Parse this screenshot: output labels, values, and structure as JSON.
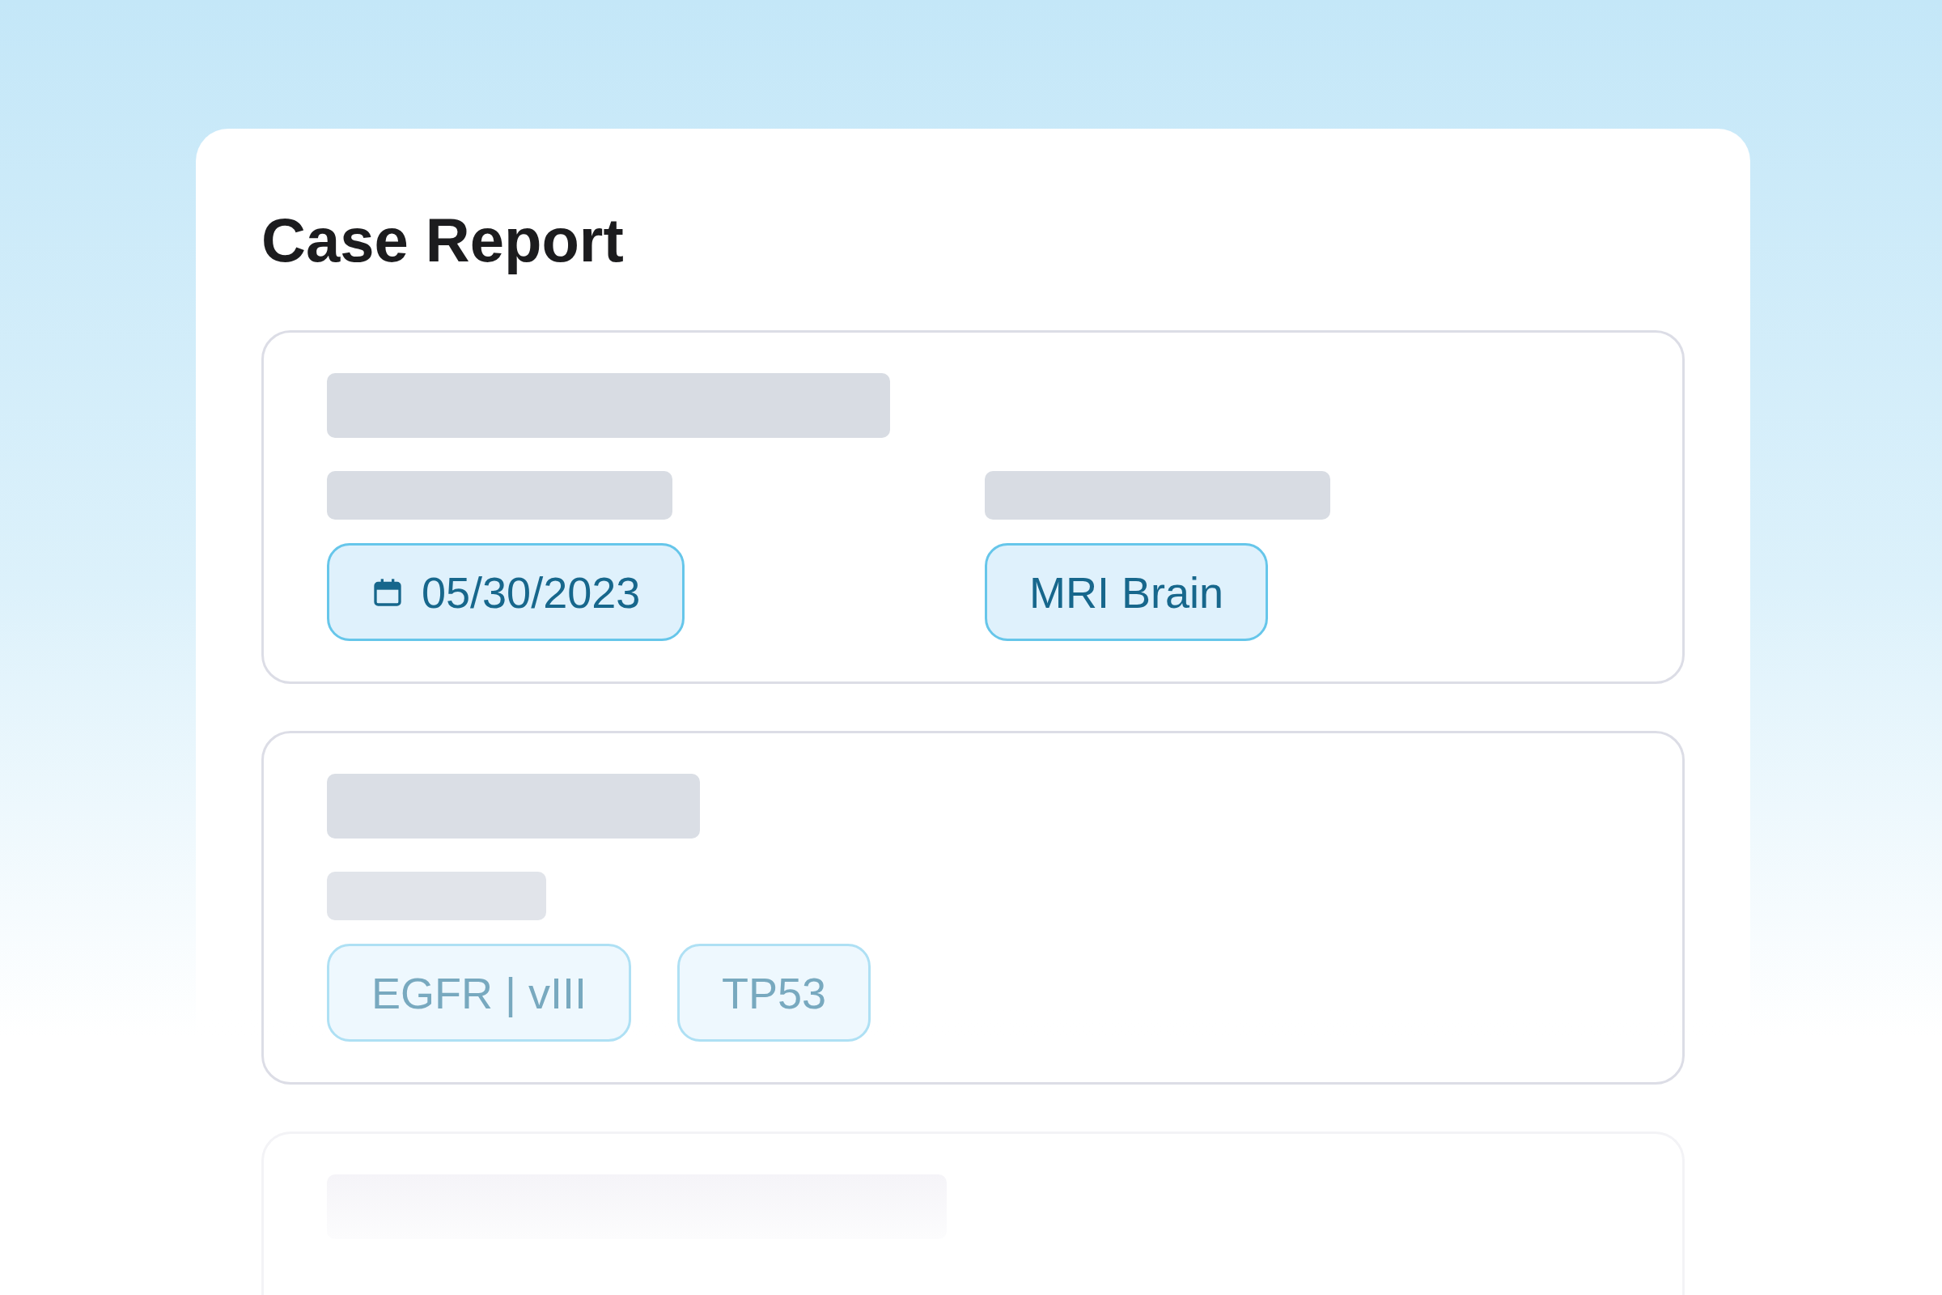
{
  "title": "Case Report",
  "sections": [
    {
      "kind": "columns",
      "muted": false,
      "tags": [
        {
          "kind": "date",
          "text": "05/30/2023"
        },
        {
          "kind": "plain",
          "text": "MRI Brain"
        }
      ]
    },
    {
      "kind": "stacked",
      "muted": true,
      "tags": [
        {
          "kind": "plain",
          "text": "EGFR | vIII"
        },
        {
          "kind": "plain",
          "text": "TP53"
        }
      ]
    }
  ]
}
